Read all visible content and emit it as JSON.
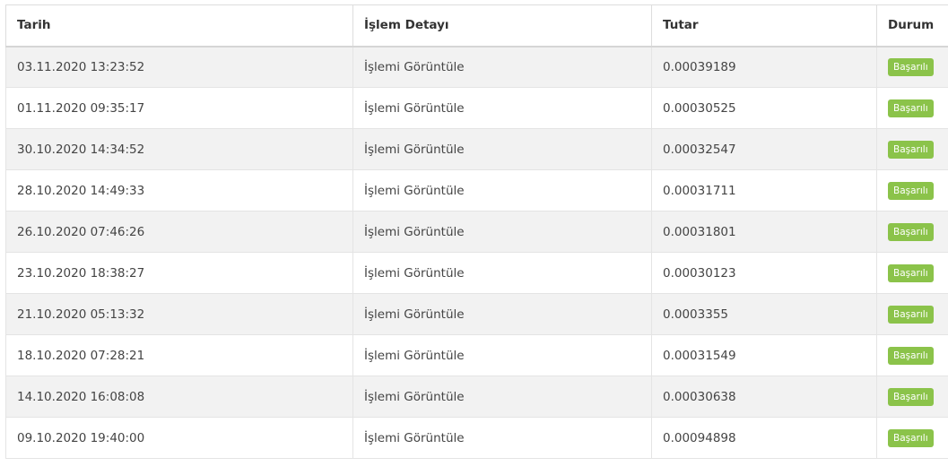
{
  "table": {
    "headers": {
      "date": "Tarih",
      "detail": "İşlem Detayı",
      "amount": "Tutar",
      "status": "Durum"
    },
    "rows": [
      {
        "date": "03.11.2020 13:23:52",
        "detail": "İşlemi Görüntüle",
        "amount": "0.00039189",
        "status": "Başarılı"
      },
      {
        "date": "01.11.2020 09:35:17",
        "detail": "İşlemi Görüntüle",
        "amount": "0.00030525",
        "status": "Başarılı"
      },
      {
        "date": "30.10.2020 14:34:52",
        "detail": "İşlemi Görüntüle",
        "amount": "0.00032547",
        "status": "Başarılı"
      },
      {
        "date": "28.10.2020 14:49:33",
        "detail": "İşlemi Görüntüle",
        "amount": "0.00031711",
        "status": "Başarılı"
      },
      {
        "date": "26.10.2020 07:46:26",
        "detail": "İşlemi Görüntüle",
        "amount": "0.00031801",
        "status": "Başarılı"
      },
      {
        "date": "23.10.2020 18:38:27",
        "detail": "İşlemi Görüntüle",
        "amount": "0.00030123",
        "status": "Başarılı"
      },
      {
        "date": "21.10.2020 05:13:32",
        "detail": "İşlemi Görüntüle",
        "amount": "0.0003355",
        "status": "Başarılı"
      },
      {
        "date": "18.10.2020 07:28:21",
        "detail": "İşlemi Görüntüle",
        "amount": "0.00031549",
        "status": "Başarılı"
      },
      {
        "date": "14.10.2020 16:08:08",
        "detail": "İşlemi Görüntüle",
        "amount": "0.00030638",
        "status": "Başarılı"
      },
      {
        "date": "09.10.2020 19:40:00",
        "detail": "İşlemi Görüntüle",
        "amount": "0.00094898",
        "status": "Başarılı"
      }
    ]
  },
  "colors": {
    "success_badge": "#8bc34a",
    "row_stripe": "#f2f2f2",
    "border": "#dddddd"
  }
}
